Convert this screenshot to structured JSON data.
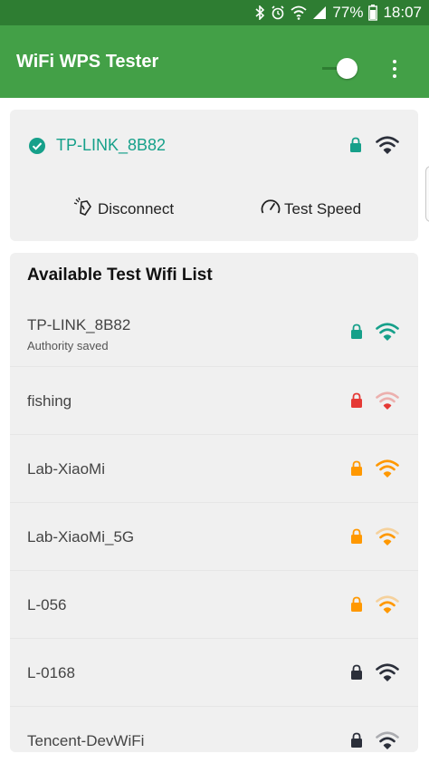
{
  "status_bar": {
    "battery": "77%",
    "time": "18:07",
    "icons": [
      "bluetooth-icon",
      "alarm-icon",
      "wifi-icon",
      "signal-icon",
      "battery-icon"
    ]
  },
  "app_bar": {
    "title": "WiFi WPS Tester",
    "toggle_on": true,
    "menu_icon": "more-vert-icon"
  },
  "connected": {
    "ssid": "TP-LINK_8B82",
    "status_icon": "check-circle-icon",
    "lock_color": "#16a08a",
    "signal_color": "#2b2f3a",
    "disconnect_label": "Disconnect",
    "test_speed_label": "Test Speed"
  },
  "list": {
    "title": "Available Test Wifi List",
    "items": [
      {
        "ssid": "TP-LINK_8B82",
        "subtitle": "Authority saved",
        "lock_color": "#16a08a",
        "wifi_color": "#16a08a",
        "strength": 3
      },
      {
        "ssid": "fishing",
        "subtitle": "",
        "lock_color": "#e53935",
        "wifi_color": "#e53935",
        "strength": 1
      },
      {
        "ssid": "Lab-XiaoMi",
        "subtitle": "",
        "lock_color": "#ff9800",
        "wifi_color": "#ff9800",
        "strength": 3
      },
      {
        "ssid": "Lab-XiaoMi_5G",
        "subtitle": "",
        "lock_color": "#ff9800",
        "wifi_color": "#ff9800",
        "strength": 2
      },
      {
        "ssid": "L-056",
        "subtitle": "",
        "lock_color": "#ff9800",
        "wifi_color": "#ff9800",
        "strength": 2
      },
      {
        "ssid": "L-0168",
        "subtitle": "",
        "lock_color": "#2b2f3a",
        "wifi_color": "#2b2f3a",
        "strength": 3
      },
      {
        "ssid": "Tencent-DevWiFi",
        "subtitle": "",
        "lock_color": "#2b2f3a",
        "wifi_color": "#2b2f3a",
        "strength": 2
      }
    ]
  },
  "colors": {
    "app_bar": "#43a047",
    "status_bar": "#2e7d32",
    "accent": "#16a08a",
    "card_bg": "#f0f0f0"
  }
}
